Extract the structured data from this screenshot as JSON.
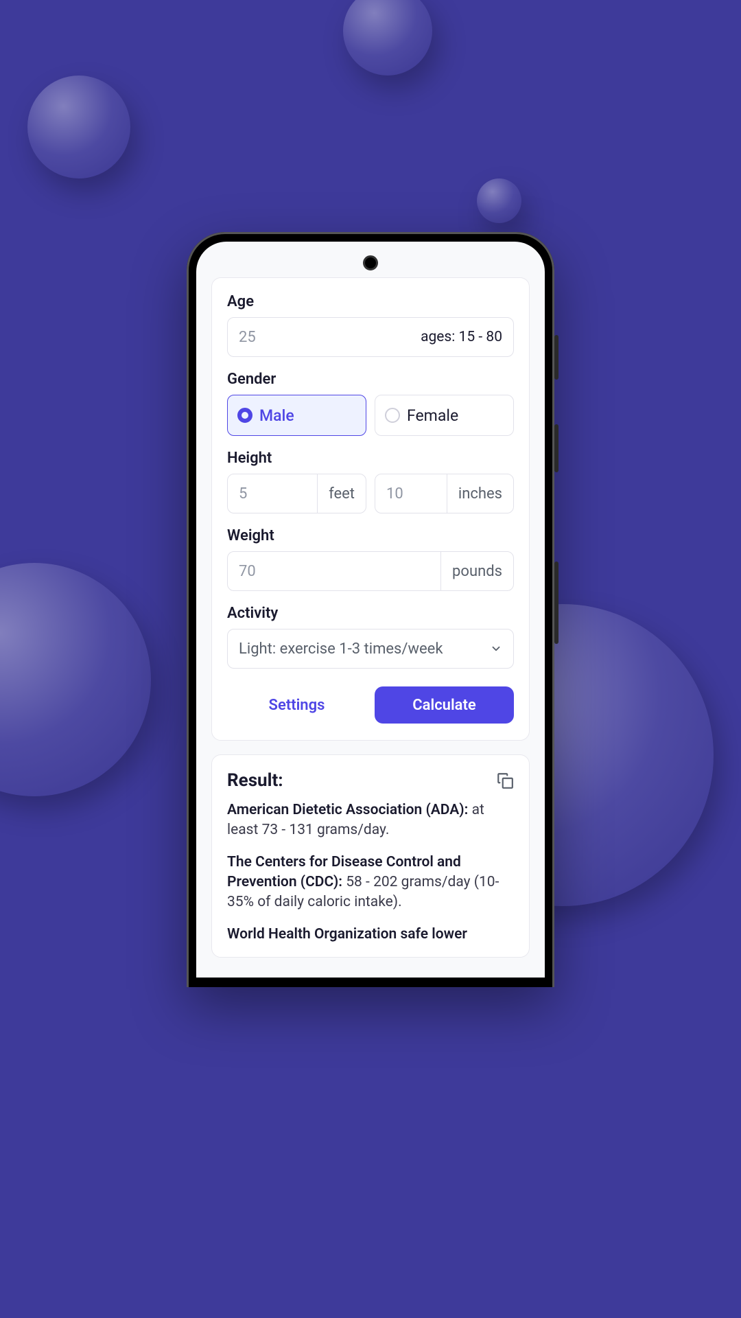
{
  "form": {
    "age": {
      "label": "Age",
      "value": "25",
      "hint": "ages: 15 - 80"
    },
    "gender": {
      "label": "Gender",
      "options": {
        "male": "Male",
        "female": "Female"
      },
      "selected": "male"
    },
    "height": {
      "label": "Height",
      "feet_value": "5",
      "feet_unit": "feet",
      "inches_value": "10",
      "inches_unit": "inches"
    },
    "weight": {
      "label": "Weight",
      "value": "70",
      "unit": "pounds"
    },
    "activity": {
      "label": "Activity",
      "selected": "Light: exercise 1-3 times/week"
    },
    "buttons": {
      "settings": "Settings",
      "calculate": "Calculate"
    }
  },
  "result": {
    "heading": "Result:",
    "items": {
      "ada_label": "American Dietetic Association (ADA):",
      "ada_text": " at least 73 - 131 grams/day.",
      "cdc_label": "The Centers for Disease Control and Prevention (CDC):",
      "cdc_text": " 58 - 202 grams/day (10-35% of daily caloric intake).",
      "who_label": "World Health Organization safe lower"
    }
  },
  "colors": {
    "primary": "#4f46e5",
    "background": "#3e3a9a"
  }
}
